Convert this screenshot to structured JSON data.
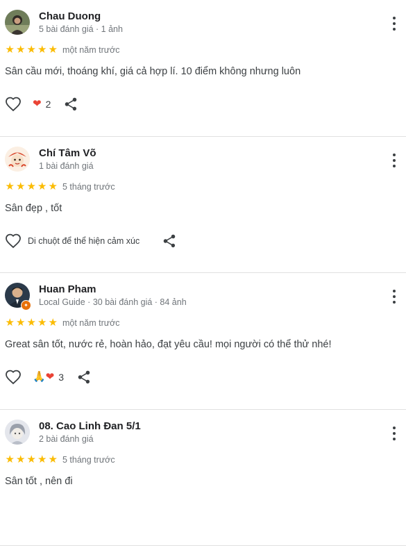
{
  "reviews": [
    {
      "name": "Chau Duong",
      "meta": "5 bài đánh giá · 1 ảnh",
      "time": "một năm trước",
      "text": "Sân cầu mới, thoáng khí, giá cả hợp lí. 10 điểm không nhưng luôn",
      "reactions": "❤",
      "reaction_count": "2",
      "rating": 5
    },
    {
      "name": "Chí Tâm Võ",
      "meta": "1 bài đánh giá",
      "time": "5 tháng trước",
      "text": "Sân đẹp , tốt",
      "hint": "Di chuột để thể hiện cảm xúc",
      "rating": 5
    },
    {
      "name": "Huan Pham",
      "meta": "Local Guide · 30 bài đánh giá · 84 ảnh",
      "time": "một năm trước",
      "text": "Great sân tốt, nước rẻ, hoàn hảo, đạt yêu cầu! mọi người có thể thử nhé!",
      "reactions": "🙏❤",
      "reaction_count": "3",
      "rating": 5
    },
    {
      "name": "08. Cao Linh Đan 5/1",
      "meta": "2 bài đánh giá",
      "time": "5 tháng trước",
      "text": "Sân tốt , nên đi",
      "rating": 5
    }
  ],
  "star_char": "★",
  "colors": {
    "star": "#fbbc04",
    "heart": "#ea4335",
    "badge": "#e8710a",
    "secondary_text": "#70757a"
  },
  "icons": [
    "more-vert-icon",
    "star-icon",
    "heart-outline-icon",
    "share-icon",
    "local-guide-badge-icon"
  ]
}
